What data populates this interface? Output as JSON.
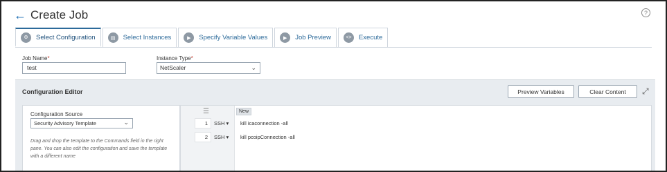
{
  "header": {
    "back_icon": "arrow-left-icon",
    "title": "Create Job",
    "help_icon": "help-icon",
    "help_glyph": "?"
  },
  "tabs": [
    {
      "label": "Select Configuration",
      "icon": "gear-icon",
      "active": true
    },
    {
      "label": "Select Instances",
      "icon": "server-icon",
      "active": false
    },
    {
      "label": "Specify Variable Values",
      "icon": "variable-icon",
      "active": false
    },
    {
      "label": "Job Preview",
      "icon": "preview-icon",
      "active": false
    },
    {
      "label": "Execute",
      "icon": "code-icon",
      "active": false
    }
  ],
  "form": {
    "job_name": {
      "label": "Job Name",
      "required": "*",
      "value": "test"
    },
    "instance_type": {
      "label": "Instance Type",
      "required": "*",
      "value": "NetScaler"
    }
  },
  "editor": {
    "title": "Configuration Editor",
    "preview_button": "Preview Variables",
    "clear_button": "Clear Content",
    "source_label": "Configuration Source",
    "source_value": "Security Advisory Template",
    "help_text": "Drag and drop the template to the Commands field in the right pane. You can also edit the configuration and save the template with a different name",
    "new_badge": "New",
    "commands": [
      {
        "num": "1",
        "type": "SSH",
        "text": "kill icaconnection -all"
      },
      {
        "num": "2",
        "type": "SSH",
        "text": "kill pcoipConnection -all"
      }
    ]
  },
  "colors": {
    "accent": "#2c6a9a",
    "editor_bg": "#e8ecf0",
    "required": "#c0392b"
  }
}
